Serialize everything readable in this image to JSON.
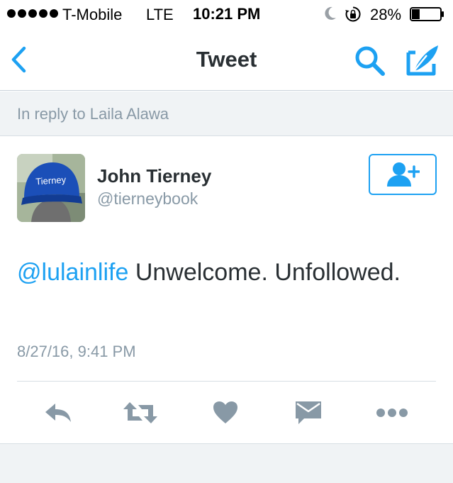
{
  "status_bar": {
    "carrier": "T-Mobile",
    "network": "LTE",
    "time": "10:21 PM",
    "battery_percent": "28%",
    "battery_level": 0.28,
    "signal_bars": 5
  },
  "nav": {
    "title": "Tweet",
    "back_icon": "chevron-left-icon",
    "search_icon": "search-icon",
    "compose_icon": "compose-quill-icon"
  },
  "reply_context": {
    "text": "In reply to Laila Alawa"
  },
  "tweet": {
    "author": {
      "name": "John Tierney",
      "handle": "@tierneybook",
      "avatar_cap_text": "Tierney"
    },
    "mention": "@lulainlife",
    "body": " Unwelcome. Unfollowed.",
    "timestamp": "8/27/16, 9:41 PM"
  },
  "actions": [
    "reply-icon",
    "retweet-icon",
    "like-heart-icon",
    "direct-message-icon",
    "more-icon"
  ],
  "colors": {
    "accent": "#1da1f2",
    "icon_gray": "#8899a6",
    "text": "#292f33",
    "background_gray": "#f0f3f5"
  }
}
